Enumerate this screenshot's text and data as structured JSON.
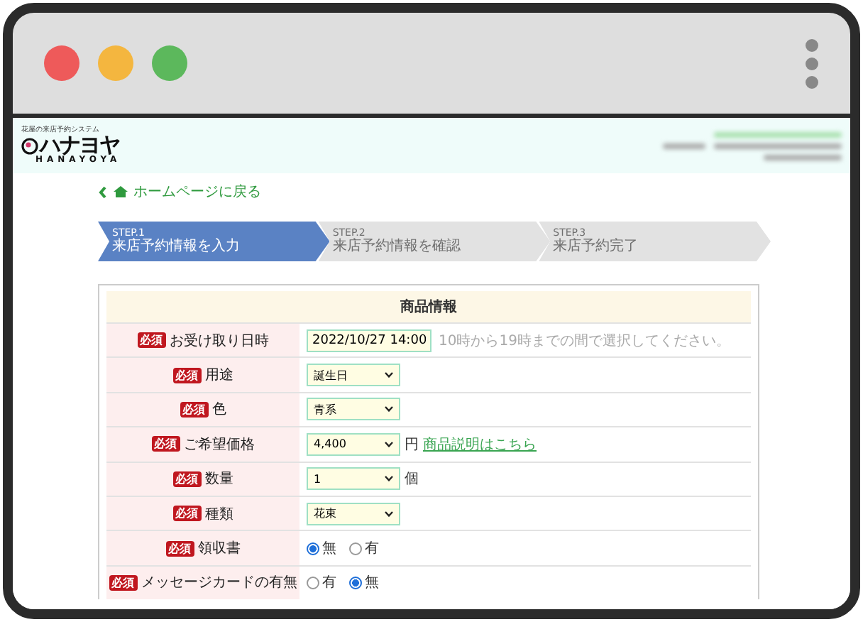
{
  "header": {
    "tagline": "花屋の来店予約システム",
    "logo": "ハナヨヤ",
    "logo_sub": "HANAYOYA"
  },
  "back_link": "ホームページに戻る",
  "steps": [
    {
      "step": "STEP.1",
      "label": "来店予約情報を入力",
      "selected": true
    },
    {
      "step": "STEP.2",
      "label": "来店予約情報を確認",
      "selected": false
    },
    {
      "step": "STEP.3",
      "label": "来店予約完了",
      "selected": false
    }
  ],
  "form": {
    "title": "商品情報",
    "rows": [
      {
        "kind": "text",
        "badge": "必須",
        "label": "お受け取り日時",
        "value": "2022/10/27 14:00",
        "hint": "10時から19時までの間で選択してください。"
      },
      {
        "kind": "select",
        "badge": "必須",
        "label": "用途",
        "value": "誕生日"
      },
      {
        "kind": "select",
        "badge": "必須",
        "label": "色",
        "value": "青系"
      },
      {
        "kind": "select",
        "badge": "必須",
        "label": "ご希望価格",
        "value": "4,400",
        "unit": "円",
        "link": "商品説明はこちら"
      },
      {
        "kind": "select",
        "badge": "必須",
        "label": "数量",
        "value": "1",
        "unit": "個"
      },
      {
        "kind": "select",
        "badge": "必須",
        "label": "種類",
        "value": "花束"
      },
      {
        "kind": "radio",
        "badge": "必須",
        "label": "領収書",
        "options": [
          {
            "label": "無",
            "selected": true
          },
          {
            "label": "有",
            "selected": false
          }
        ]
      },
      {
        "kind": "radio",
        "badge": "必須",
        "label": "メッセージカードの有無",
        "options": [
          {
            "label": "有",
            "selected": false
          },
          {
            "label": "無",
            "selected": true
          }
        ]
      }
    ]
  }
}
